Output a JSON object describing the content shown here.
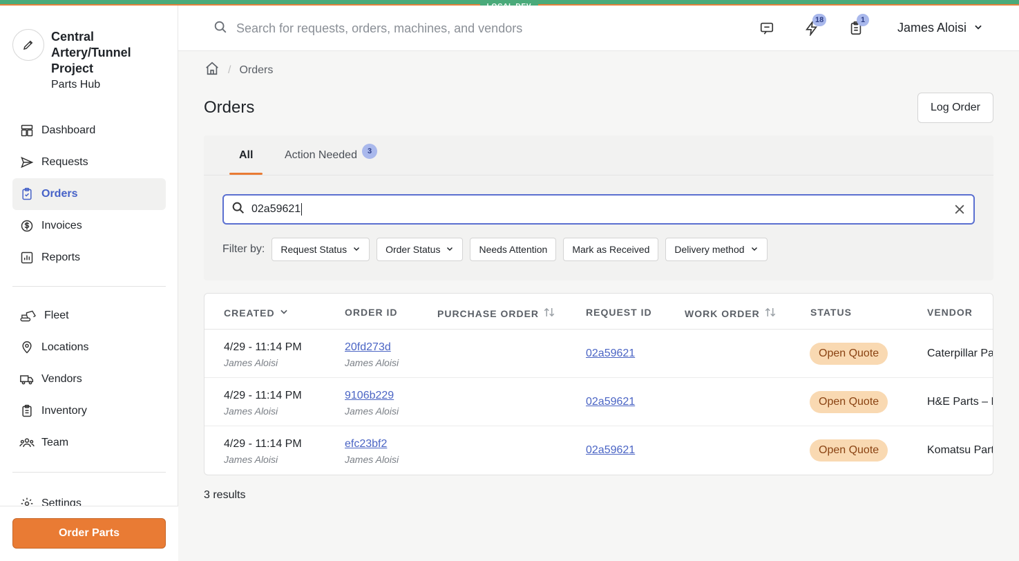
{
  "env_badge": "LOCAL DEV",
  "brand": {
    "name": "Central Artery/Tunnel Project",
    "sub": "Parts Hub"
  },
  "sidebar": {
    "primary": [
      {
        "label": "Dashboard",
        "icon": "dashboard-icon"
      },
      {
        "label": "Requests",
        "icon": "send-icon"
      },
      {
        "label": "Orders",
        "icon": "clipboard-check-icon",
        "active": true
      },
      {
        "label": "Invoices",
        "icon": "dollar-circle-icon"
      },
      {
        "label": "Reports",
        "icon": "bar-chart-icon"
      }
    ],
    "secondary": [
      {
        "label": "Fleet",
        "icon": "excavator-icon"
      },
      {
        "label": "Locations",
        "icon": "map-pin-icon"
      },
      {
        "label": "Vendors",
        "icon": "truck-icon"
      },
      {
        "label": "Inventory",
        "icon": "clipboard-list-icon"
      },
      {
        "label": "Team",
        "icon": "team-icon"
      }
    ],
    "settings": "Settings",
    "order_parts": "Order Parts"
  },
  "header": {
    "search_placeholder": "Search for requests, orders, machines, and vendors",
    "notifications_count": "18",
    "tasks_count": "1",
    "user_name": "James Aloisi"
  },
  "breadcrumb": {
    "current": "Orders"
  },
  "page": {
    "title": "Orders",
    "log_order": "Log Order"
  },
  "tabs": {
    "all": "All",
    "action_needed": "Action Needed",
    "action_needed_count": "3"
  },
  "search": {
    "value": "02a59621"
  },
  "filters": {
    "label": "Filter by:",
    "chips": [
      {
        "label": "Request Status",
        "dropdown": true
      },
      {
        "label": "Order Status",
        "dropdown": true
      },
      {
        "label": "Needs Attention",
        "dropdown": false
      },
      {
        "label": "Mark as Received",
        "dropdown": false
      },
      {
        "label": "Delivery method",
        "dropdown": true
      }
    ]
  },
  "table": {
    "columns": [
      "CREATED",
      "ORDER ID",
      "PURCHASE ORDER",
      "REQUEST ID",
      "WORK ORDER",
      "STATUS",
      "VENDOR"
    ],
    "rows": [
      {
        "created": "4/29 - 11:14 PM",
        "created_by": "James Aloisi",
        "order_id": "20fd273d",
        "order_by": "James Aloisi",
        "purchase_order": "",
        "request_id": "02a59621",
        "work_order": "",
        "status": "Open Quote",
        "vendor": "Caterpillar Parts"
      },
      {
        "created": "4/29 - 11:14 PM",
        "created_by": "James Aloisi",
        "order_id": "9106b229",
        "order_by": "James Aloisi",
        "purchase_order": "",
        "request_id": "02a59621",
        "work_order": "",
        "status": "Open Quote",
        "vendor": "H&E Parts – E"
      },
      {
        "created": "4/29 - 11:14 PM",
        "created_by": "James Aloisi",
        "order_id": "efc23bf2",
        "order_by": "James Aloisi",
        "purchase_order": "",
        "request_id": "02a59621",
        "work_order": "",
        "status": "Open Quote",
        "vendor": "Komatsu Parts"
      }
    ]
  },
  "results_text": "3 results",
  "colors": {
    "accent": "#4662c8",
    "brand_orange": "#e97b34",
    "env_green": "#4aaa7a",
    "status_pill": "#f9d9b2"
  }
}
